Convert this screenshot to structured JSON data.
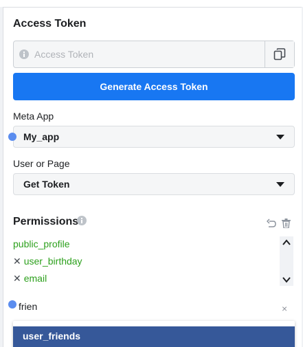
{
  "access_token": {
    "title": "Access Token",
    "placeholder": "Access Token",
    "copy_icon": "copy-icon",
    "generate_label": "Generate Access Token"
  },
  "meta_app": {
    "label": "Meta App",
    "value": "My_app"
  },
  "user_or_page": {
    "label": "User or Page",
    "value": "Get Token"
  },
  "permissions": {
    "title": "Permissions",
    "items": [
      {
        "label": "public_profile",
        "removable": false
      },
      {
        "label": "user_birthday",
        "removable": true
      },
      {
        "label": "email",
        "removable": true
      }
    ],
    "remove_glyph": "✕"
  },
  "search": {
    "value": "frien",
    "clear_glyph": "×",
    "suggestions": [
      "user_friends"
    ]
  },
  "colors": {
    "primary": "#1877f2",
    "permission_green": "#2ca01c",
    "selected_suggestion": "#365899"
  }
}
